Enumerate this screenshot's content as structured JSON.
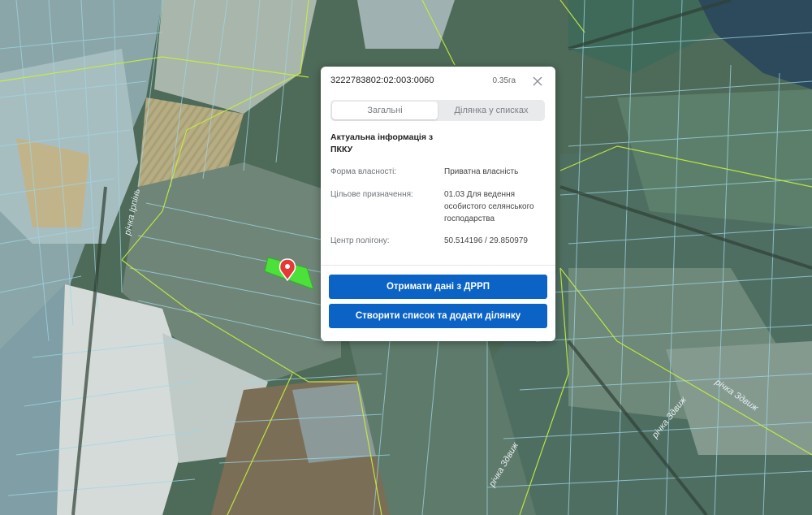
{
  "popup": {
    "cadastral_number": "3222783802:02:003:0060",
    "area": "0.35га",
    "tabs": [
      "Загальні",
      "Ділянка у списках"
    ],
    "section_title": "Актуальна інформація з ПККУ",
    "rows": [
      {
        "label": "Форма власності:",
        "value": "Приватна власність"
      },
      {
        "label": "Цільове призначення:",
        "value": "01.03 Для ведення особистого селянського господарства"
      },
      {
        "label": "Центр полігону:",
        "value": "50.514196 / 29.850979"
      }
    ],
    "buttons": {
      "drrp": "Отримати дані з ДРРП",
      "create_list": "Створити список та додати ділянку"
    }
  },
  "map": {
    "river_labels": [
      "річка Ірпінь",
      "річка Здвиж",
      "річка Здвиж",
      "річка Здвиж"
    ],
    "parcel_outline_color": "#c6f03c",
    "selected_parcel_color": "#4ce03a",
    "marker_color": "#e53935",
    "icons": {
      "marker": "map-pin-icon",
      "close": "close-icon"
    }
  }
}
